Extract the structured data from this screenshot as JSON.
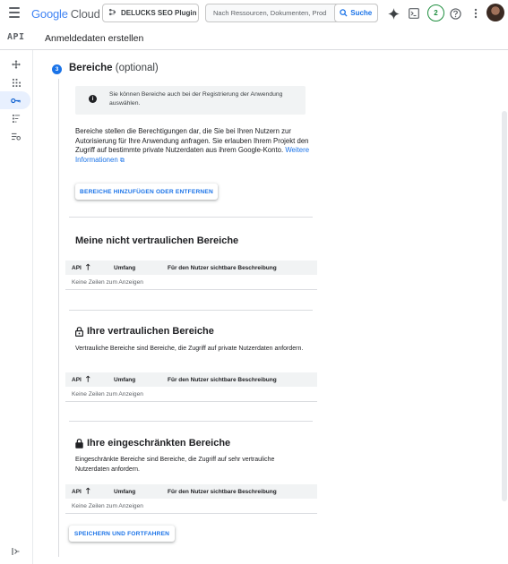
{
  "topbar": {
    "brand_google": "Google",
    "brand_cloud": "Cloud",
    "project_label": "DELUCKS SEO Plugin",
    "search_placeholder": "Nach Ressourcen, Dokumenten, Prod",
    "search_button": "Suche",
    "notification_count": "2"
  },
  "apibar": {
    "logo": "API",
    "title": "Anmeldedaten erstellen"
  },
  "step": {
    "number": "3",
    "title": "Bereiche",
    "optional": "(optional)"
  },
  "info": {
    "text": "Sie können Bereiche auch bei der Registrierung der Anwendung auswählen."
  },
  "description": {
    "text": "Bereiche stellen die Berechtigungen dar, die Sie bei Ihren Nutzern zur Autorisierung für Ihre Anwendung anfragen. Sie erlauben Ihrem Projekt den Zugriff auf bestimmte private Nutzerdaten aus ihrem Google-Konto.",
    "link": "Weitere Informationen"
  },
  "buttons": {
    "scopes": "BEREICHE HINZUFÜGEN ODER ENTFERNEN",
    "save": "SPEICHERN UND FORTFAHREN"
  },
  "table_columns": {
    "api": "API",
    "scope": "Umfang",
    "desc": "Für den Nutzer sichtbare Beschreibung",
    "empty": "Keine Zeilen zum Anzeigen"
  },
  "sections": {
    "nonsensitive": {
      "title": "Meine nicht vertraulichen Bereiche"
    },
    "sensitive": {
      "title": "Ihre vertraulichen Bereiche",
      "desc": "Vertrauliche Bereiche sind Bereiche, die Zugriff auf private Nutzerdaten anfordern."
    },
    "restricted": {
      "title": "Ihre eingeschränkten Bereiche",
      "desc": "Eingeschränkte Bereiche sind Bereiche, die Zugriff auf sehr vertrauliche Nutzerdaten anfordern."
    }
  },
  "colors": {
    "accent": "#1a73e8",
    "step_badge": "#1a73e8",
    "notification": "#1e8e3e"
  },
  "icons": [
    "menu-icon",
    "project-icon",
    "search-icon",
    "gemini-icon",
    "terminal-icon",
    "help-icon",
    "more-icon",
    "info-icon",
    "external-link-icon",
    "arrow-up-icon",
    "lock-open-icon",
    "lock-icon"
  ]
}
